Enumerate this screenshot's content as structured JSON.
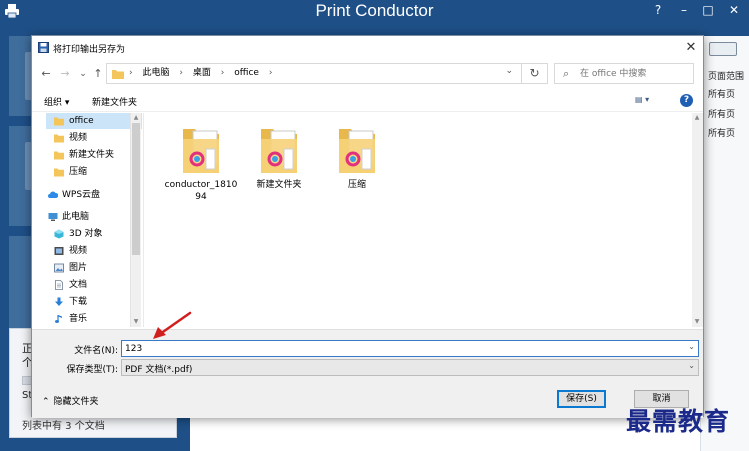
{
  "app": {
    "title": "Print Conductor",
    "help": "?",
    "minimize": "–",
    "maximize": "□",
    "close": "✕",
    "status_text": "列表中有 3 个文档",
    "status_frag_1": "正",
    "status_frag_2": "个",
    "status_frag_3": "St",
    "right_col": [
      "页面范围",
      "所有页",
      "所有页",
      "所有页"
    ]
  },
  "dialog": {
    "title": "将打印输出另存为",
    "close": "✕",
    "nav": {
      "back": "←",
      "forward": "→",
      "dropdown": "⌄",
      "up": "↑"
    },
    "breadcrumb": [
      "此电脑",
      "桌面",
      "office"
    ],
    "breadcrumb_sep": "›",
    "addr_dropdown": "⌄",
    "refresh": "↻",
    "search_placeholder": "在 office 中搜索",
    "toolbar": {
      "organize": "组织 ▾",
      "new_folder": "新建文件夹",
      "view": "▤ ▾",
      "help": "?"
    },
    "nav_pane": [
      {
        "label": "office",
        "icon": "folder-icon",
        "selected": true
      },
      {
        "label": "视频",
        "icon": "folder-icon",
        "selected": false
      },
      {
        "label": "新建文件夹",
        "icon": "folder-icon",
        "selected": false
      },
      {
        "label": "压缩",
        "icon": "folder-icon",
        "selected": false
      },
      {
        "label": "WPS云盘",
        "icon": "cloud-icon",
        "selected": false
      },
      {
        "label": "此电脑",
        "icon": "computer-icon",
        "selected": false
      },
      {
        "label": "3D 对象",
        "icon": "cube-icon",
        "selected": false
      },
      {
        "label": "视频",
        "icon": "video-icon",
        "selected": false
      },
      {
        "label": "图片",
        "icon": "picture-icon",
        "selected": false
      },
      {
        "label": "文档",
        "icon": "document-icon",
        "selected": false
      },
      {
        "label": "下载",
        "icon": "download-icon",
        "selected": false
      },
      {
        "label": "音乐",
        "icon": "music-icon",
        "selected": false
      }
    ],
    "files": [
      {
        "name_line1": "conductor_1810",
        "name_line2": "94"
      },
      {
        "name_line1": "新建文件夹",
        "name_line2": ""
      },
      {
        "name_line1": "压缩",
        "name_line2": ""
      }
    ],
    "form": {
      "filename_label": "文件名(N):",
      "filename_value": "123",
      "filetype_label": "保存类型(T):",
      "filetype_value": "PDF 文档(*.pdf)",
      "dropdown": "⌄",
      "hide_folders": "隐藏文件夹",
      "save": "保存(S)",
      "cancel": "取消"
    }
  },
  "watermark": "最需教育",
  "colors": {
    "app_blue": "#1e4f86",
    "selection": "#cce4f7",
    "focus_blue": "#3a78c9",
    "arrow_red": "#d11f1f",
    "watermark": "#1b2a8a"
  }
}
